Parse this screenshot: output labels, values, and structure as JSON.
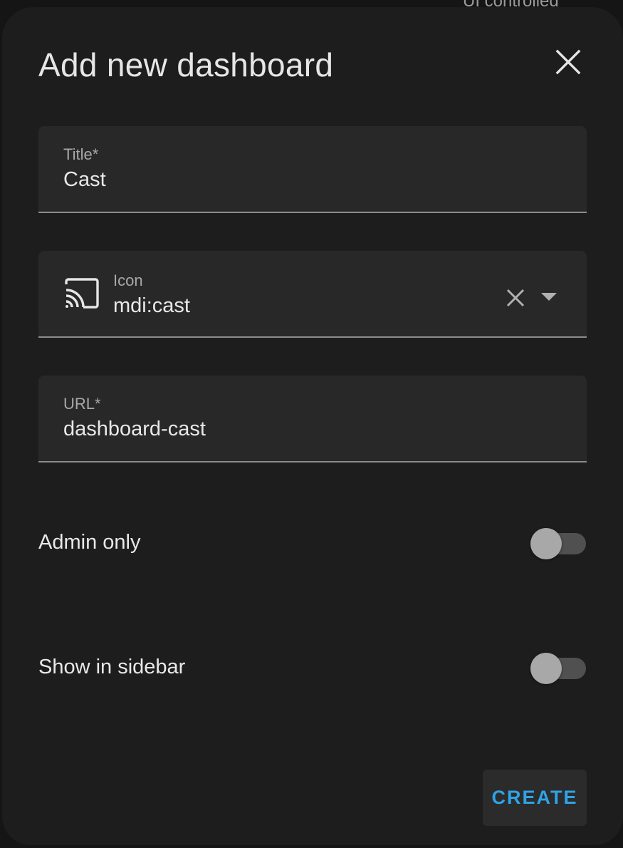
{
  "background": {
    "partial_text": "UI controlled"
  },
  "dialog": {
    "title": "Add new dashboard",
    "close_icon": "close-icon"
  },
  "fields": {
    "title": {
      "label": "Title*",
      "value": "Cast"
    },
    "icon": {
      "label": "Icon",
      "value": "mdi:cast",
      "preview_icon": "cast-icon",
      "clear_icon": "clear-icon",
      "dropdown_icon": "chevron-down-icon"
    },
    "url": {
      "label": "URL*",
      "value": "dashboard-cast"
    }
  },
  "options": {
    "admin_only": {
      "label": "Admin only",
      "checked": false
    },
    "show_in_sidebar": {
      "label": "Show in sidebar",
      "checked": false
    }
  },
  "actions": {
    "create_label": "CREATE"
  },
  "colors": {
    "accent": "#2ea3e6",
    "dialog_bg": "#1d1d1d",
    "field_bg": "#282828"
  }
}
